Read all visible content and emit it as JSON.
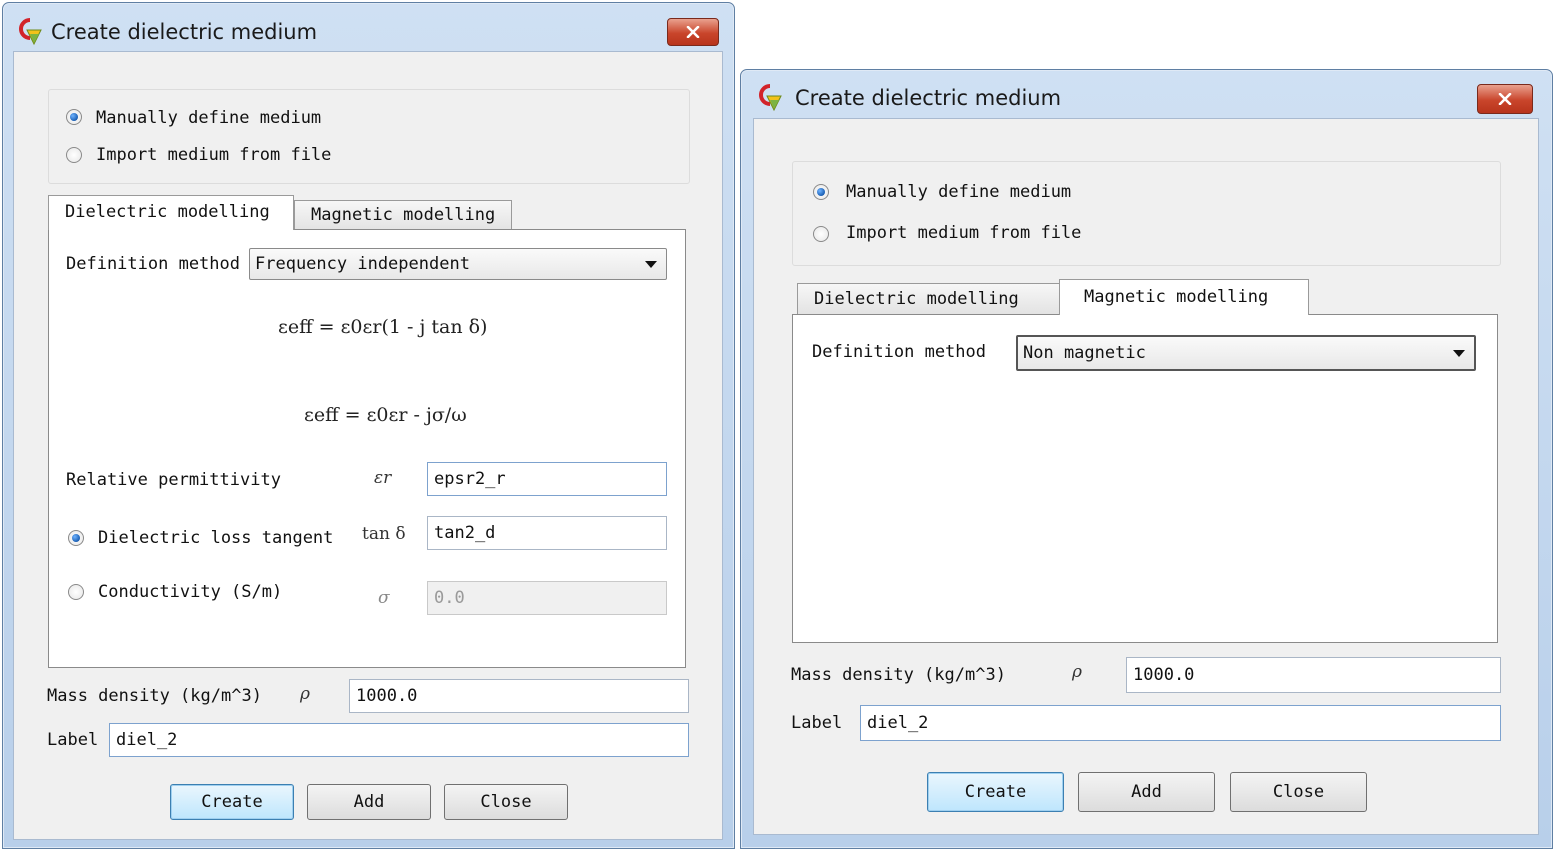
{
  "dialogs": [
    {
      "title": "Create dielectric medium",
      "source": {
        "manual_label": "Manually define medium",
        "import_label": "Import medium from file",
        "selected": "manual"
      },
      "tabs": [
        {
          "label": "Dielectric modelling",
          "active": true
        },
        {
          "label": "Magnetic modelling",
          "active": false
        }
      ],
      "definition_label": "Definition method",
      "definition_value": "Frequency independent",
      "formula_1": "εeff = ε0εr(1 - j tan δ)",
      "formula_2": "εeff = ε0εr - jσ/ω",
      "relative_permittivity_label": "Relative permittivity",
      "relative_permittivity_symbol": "εr",
      "relative_permittivity_value": "epsr2_r",
      "loss_tangent_label": "Dielectric loss tangent",
      "loss_tangent_symbol": "tan δ",
      "loss_tangent_value": "tan2_d",
      "conductivity_label": "Conductivity (S/m)",
      "conductivity_symbol": "σ",
      "conductivity_value": "0.0",
      "mass_density_label": "Mass density (kg/m^3)",
      "mass_density_symbol": "ρ",
      "mass_density_value": "1000.0",
      "label_label": "Label",
      "label_value": "diel_2",
      "buttons": {
        "create": "Create",
        "add": "Add",
        "close": "Close"
      }
    },
    {
      "title": "Create dielectric medium",
      "source": {
        "manual_label": "Manually define medium",
        "import_label": "Import medium from file",
        "selected": "manual"
      },
      "tabs": [
        {
          "label": "Dielectric modelling",
          "active": false
        },
        {
          "label": "Magnetic modelling",
          "active": true
        }
      ],
      "definition_label": "Definition method",
      "definition_value": "Non magnetic",
      "mass_density_label": "Mass density (kg/m^3)",
      "mass_density_symbol": "ρ",
      "mass_density_value": "1000.0",
      "label_label": "Label",
      "label_value": "diel_2",
      "buttons": {
        "create": "Create",
        "add": "Add",
        "close": "Close"
      }
    }
  ]
}
